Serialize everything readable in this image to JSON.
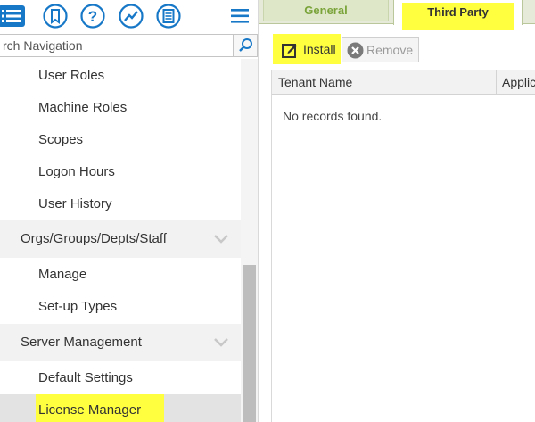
{
  "toolbar_icons": [
    {
      "name": "hamburger-blue-icon"
    },
    {
      "name": "bookmark-icon"
    },
    {
      "name": "help-icon"
    },
    {
      "name": "trend-icon"
    },
    {
      "name": "report-icon"
    },
    {
      "name": "menu-icon"
    }
  ],
  "search": {
    "value": "rch Navigation",
    "icon": "search-icon"
  },
  "nav": {
    "items": [
      {
        "label": "User Roles"
      },
      {
        "label": "Machine Roles"
      },
      {
        "label": "Scopes"
      },
      {
        "label": "Logon Hours"
      },
      {
        "label": "User History"
      }
    ],
    "group_orgs": {
      "label": "Orgs/Groups/Depts/Staff"
    },
    "orgs_items": [
      {
        "label": "Manage"
      },
      {
        "label": "Set-up Types"
      }
    ],
    "group_server": {
      "label": "Server Management"
    },
    "server_items": [
      {
        "label": "Default Settings"
      },
      {
        "label": "License Manager"
      }
    ]
  },
  "tabs": {
    "general": "General",
    "third_party": "Third Party"
  },
  "actions": {
    "install": "Install",
    "remove": "Remove"
  },
  "grid": {
    "columns": [
      "Tenant Name",
      "Applic"
    ],
    "empty_message": "No records found."
  },
  "colors": {
    "accent_blue": "#1878c8",
    "highlight": "#ffff40",
    "tab_green": "#7aa43a"
  }
}
